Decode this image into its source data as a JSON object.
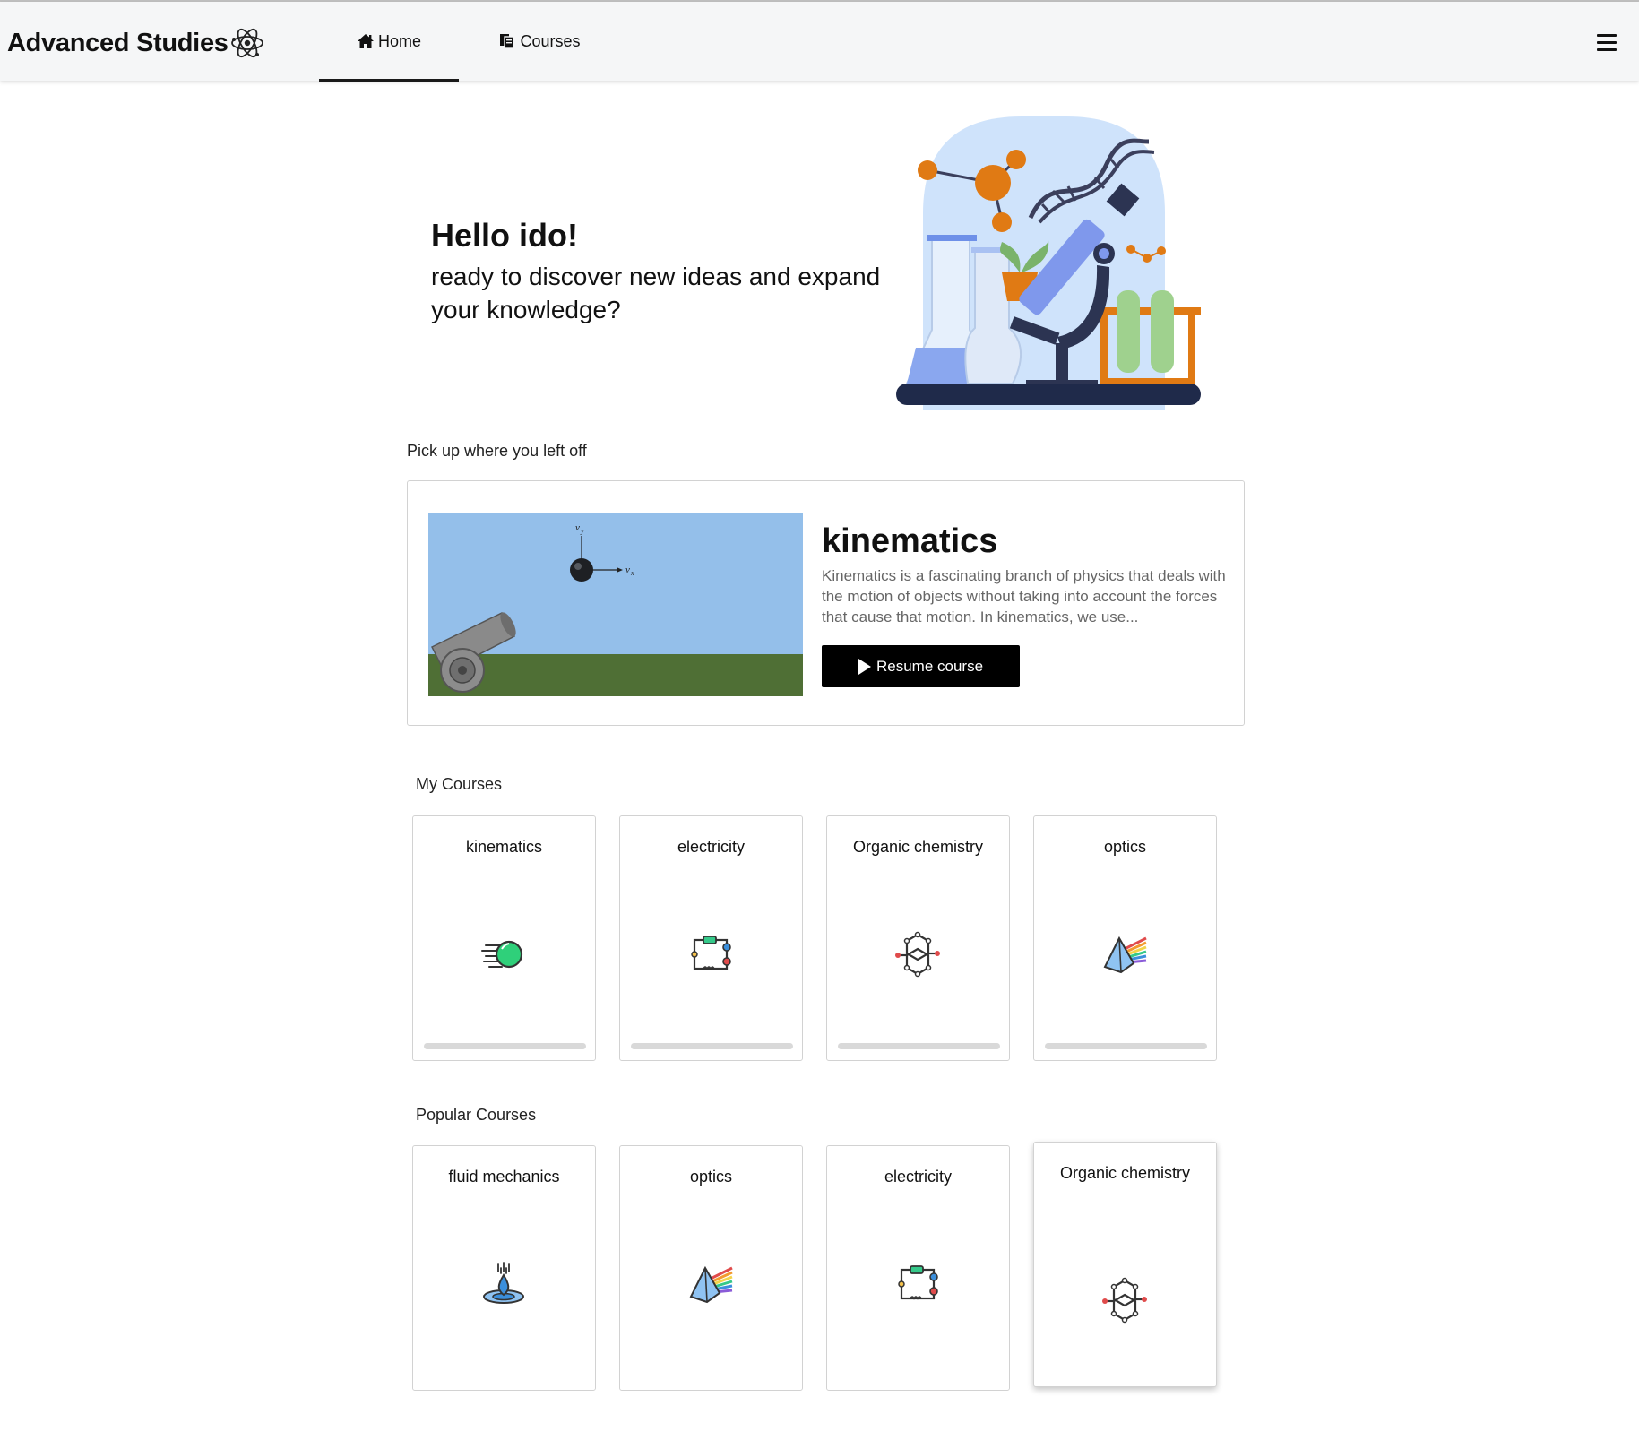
{
  "app": {
    "brand": "Advanced Studies",
    "brand_icon": "atom-icon"
  },
  "nav": {
    "items": [
      {
        "label": "Home",
        "icon": "home-icon",
        "active": true
      },
      {
        "label": "Courses",
        "icon": "documents-icon",
        "active": false
      }
    ],
    "menu_icon": "hamburger-menu-icon"
  },
  "hero": {
    "greeting": "Hello ido!",
    "subtitle": "ready to discover new ideas and expand your knowledge?",
    "illustration": "science-lab-illustration"
  },
  "resume": {
    "section_label": "Pick up where you left off",
    "title": "kinematics",
    "description": "Kinematics is a fascinating branch of physics that deals with the motion of objects without taking into account the forces that cause that motion. In kinematics, we use...",
    "button_label": "Resume course",
    "image": "cannon-projectile-illustration"
  },
  "my_courses": {
    "section_label": "My Courses",
    "items": [
      {
        "title": "kinematics",
        "icon": "motion-ball-icon",
        "progress": 0
      },
      {
        "title": "electricity",
        "icon": "circuit-icon",
        "progress": 0
      },
      {
        "title": "Organic chemistry",
        "icon": "molecule-rings-icon",
        "progress": 0
      },
      {
        "title": "optics",
        "icon": "prism-icon",
        "progress": 0
      }
    ]
  },
  "popular_courses": {
    "section_label": "Popular Courses",
    "items": [
      {
        "title": "fluid mechanics",
        "icon": "water-drop-icon"
      },
      {
        "title": "optics",
        "icon": "prism-icon"
      },
      {
        "title": "electricity",
        "icon": "circuit-icon"
      },
      {
        "title": "Organic chemistry",
        "icon": "molecule-rings-icon"
      }
    ]
  },
  "colors": {
    "navbar_bg": "#f5f6f7",
    "button_bg": "#000000",
    "progress_track": "#d9d9d9",
    "sky": "#94bfea",
    "grass": "#4f6f35"
  }
}
